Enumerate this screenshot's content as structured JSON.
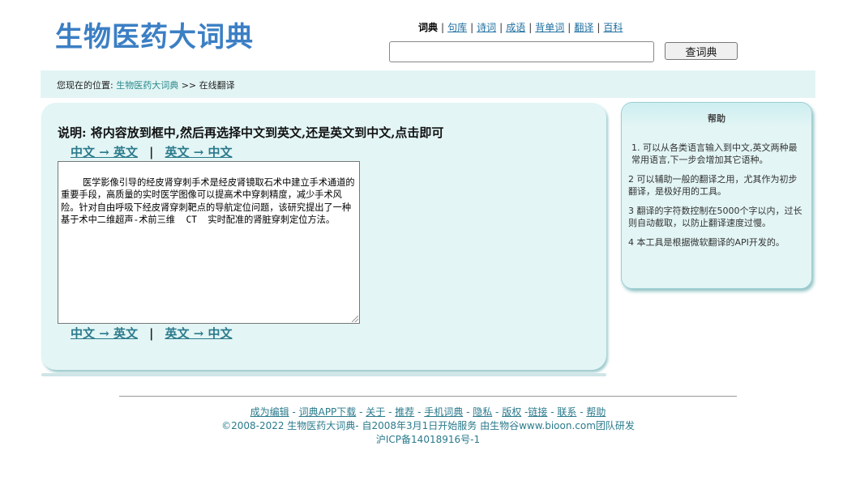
{
  "site": {
    "title": "生物医药大词典"
  },
  "topnav": {
    "items": [
      "词典",
      "句库",
      "诗词",
      "成语",
      "背单词",
      "翻译",
      "百科"
    ],
    "separators": [
      "|",
      "|",
      "|",
      "|",
      "|",
      "|"
    ]
  },
  "search": {
    "value": "",
    "placeholder": "",
    "button_label": "查词典"
  },
  "breadcrumb": {
    "prefix": "您现在的位置:",
    "home": "生物医药大词典",
    "arrow": ">>",
    "current": "在线翻译"
  },
  "translator": {
    "instruction": "说明: 将内容放到框中,然后再选择中文到英文,还是英文到中文,点击即可",
    "zh_to_en": "中文 → 英文",
    "en_to_zh": "英文 → 中文",
    "divider": "|",
    "text": "医学影像引导的经皮肾穿刺手术是经皮肾镜取石术中建立手术通道的重要手段，高质量的实时医学图像可以提高术中穿刺精度，减少手术风险。针对自由呼吸下经皮肾穿刺靶点的导航定位问题，该研究提出了一种基于术中二维超声-术前三维  CT  实时配准的肾脏穿刺定位方法。"
  },
  "help": {
    "title": "帮助",
    "items": [
      "1. 可以从各类语言输入到中文,英文两种最常用语言,下一步会增加其它语种。",
      "2 可以辅助一般的翻译之用，尤其作为初步翻译，是极好用的工具。",
      "3 翻译的字符数控制在5000个字以内，过长则自动截取，以防止翻译速度过慢。",
      "4 本工具是根据微软翻译的API开发的。"
    ]
  },
  "footer": {
    "links": [
      "成为编辑",
      "词典APP下载",
      "关于",
      "推荐",
      "手机词典",
      "隐私",
      "版权",
      "链接",
      "联系",
      "帮助"
    ],
    "copyright": "©2008-2022 生物医药大词典- 自2008年3月1日开始服务 由生物谷www.bioon.com团队研发",
    "icp": "沪ICP备14018916号-1"
  }
}
